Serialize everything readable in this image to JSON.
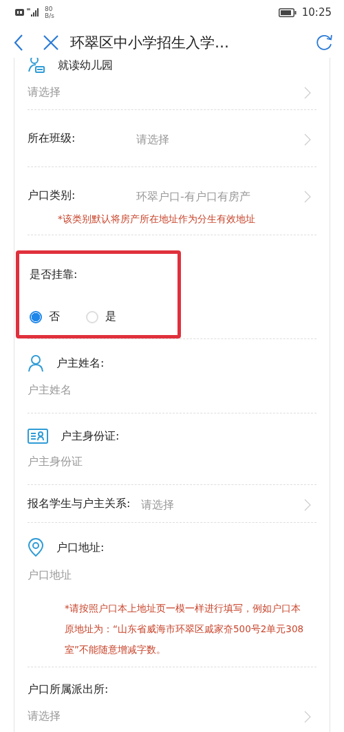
{
  "status_bar": {
    "speed_value": "80",
    "speed_unit": "B/s",
    "time": "10:25"
  },
  "nav": {
    "title": "环翠区中小学招生入学…"
  },
  "fields": [
    {
      "kind": "stacked_select",
      "label": "就读幼儿园",
      "value": "请选择"
    },
    {
      "kind": "inline_select",
      "label": "所在班级:",
      "value": "请选择"
    },
    {
      "kind": "inline_select",
      "label": "户口类别:",
      "value": "环翠户口-有户口有房产",
      "note": "*该类别默认将房产所在地址作为分生有效地址"
    },
    {
      "kind": "radio",
      "label": "是否挂靠:",
      "highlighted": true,
      "options": [
        {
          "label": "否",
          "selected": true
        },
        {
          "label": "是",
          "selected": false
        }
      ]
    },
    {
      "kind": "text_input",
      "label": "户主姓名:",
      "placeholder": "户主姓名"
    },
    {
      "kind": "text_input",
      "label": "户主身份证:",
      "placeholder": "户主身份证"
    },
    {
      "kind": "inline_select",
      "label": "报名学生与户主关系:",
      "value": "请选择",
      "compact": true
    },
    {
      "kind": "text_input",
      "label": "户口地址:",
      "placeholder": "户口地址",
      "note": "*请按照户口本上地址页一模一样进行填写，例如户口本原地址为：“山东省威海市环翠区戚家夼500号2单元308室”不能随意增减字数。"
    },
    {
      "kind": "stacked_select",
      "label": "户口所属派出所:",
      "value": "请选择"
    }
  ]
}
